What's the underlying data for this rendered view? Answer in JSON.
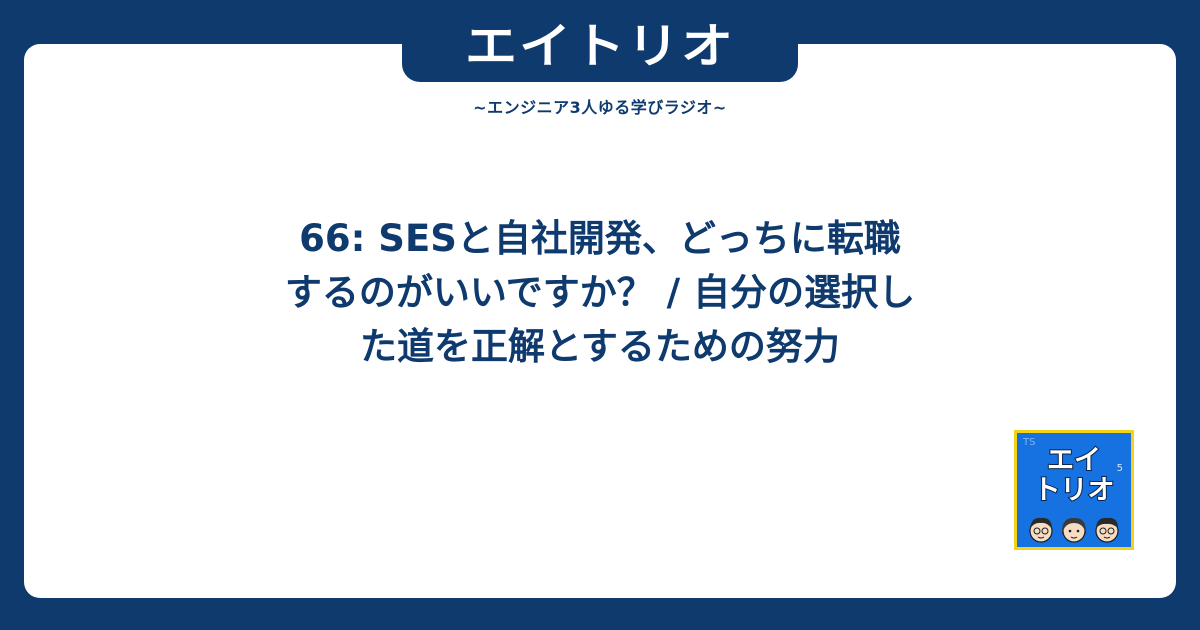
{
  "brand": {
    "logo": "エイトリオ",
    "tagline": "~エンジニア3人ゆる学びラジオ~"
  },
  "episode": {
    "title_lines": [
      "66: SESと自社開発、どっちに転職",
      "するのがいいですか？ / 自分の選択し",
      "た道を正解とするための努力"
    ]
  },
  "cover": {
    "line1": "エイ",
    "line2": "トリオ",
    "badges": [
      "TS",
      "5"
    ]
  },
  "colors": {
    "background": "#0f3a6e",
    "card": "#ffffff",
    "text": "#0f3a6e",
    "cover_bg": "#1572e0",
    "cover_border": "#f5d21a"
  }
}
